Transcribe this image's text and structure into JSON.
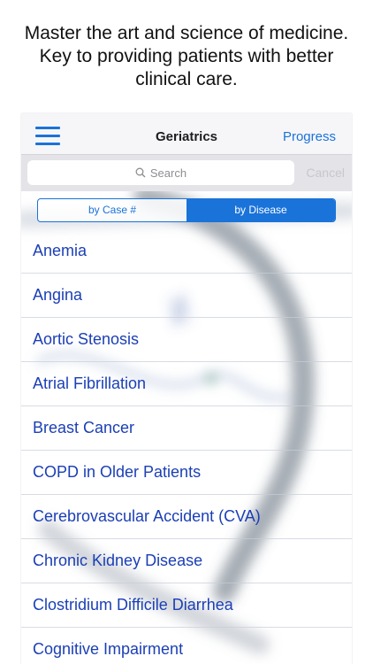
{
  "caption": {
    "line1": "Master the art and science of medicine.",
    "line2": "Key to providing patients with better",
    "line3": "clinical care."
  },
  "navbar": {
    "title": "Geriatrics",
    "progress_label": "Progress",
    "menu_icon": "hamburger-menu-icon"
  },
  "search": {
    "placeholder": "Search",
    "cancel_label": "Cancel"
  },
  "segments": {
    "by_case": "by Case #",
    "by_disease": "by Disease",
    "selected": "by Disease"
  },
  "diseases": [
    "Anemia",
    "Angina",
    "Aortic Stenosis",
    "Atrial Fibrillation",
    "Breast Cancer",
    "COPD in Older Patients",
    "Cerebrovascular Accident (CVA)",
    "Chronic Kidney Disease",
    "Clostridium Difficile Diarrhea",
    "Cognitive Impairment"
  ],
  "colors": {
    "accent": "#1a73d9",
    "list_text": "#1b3fb5"
  }
}
